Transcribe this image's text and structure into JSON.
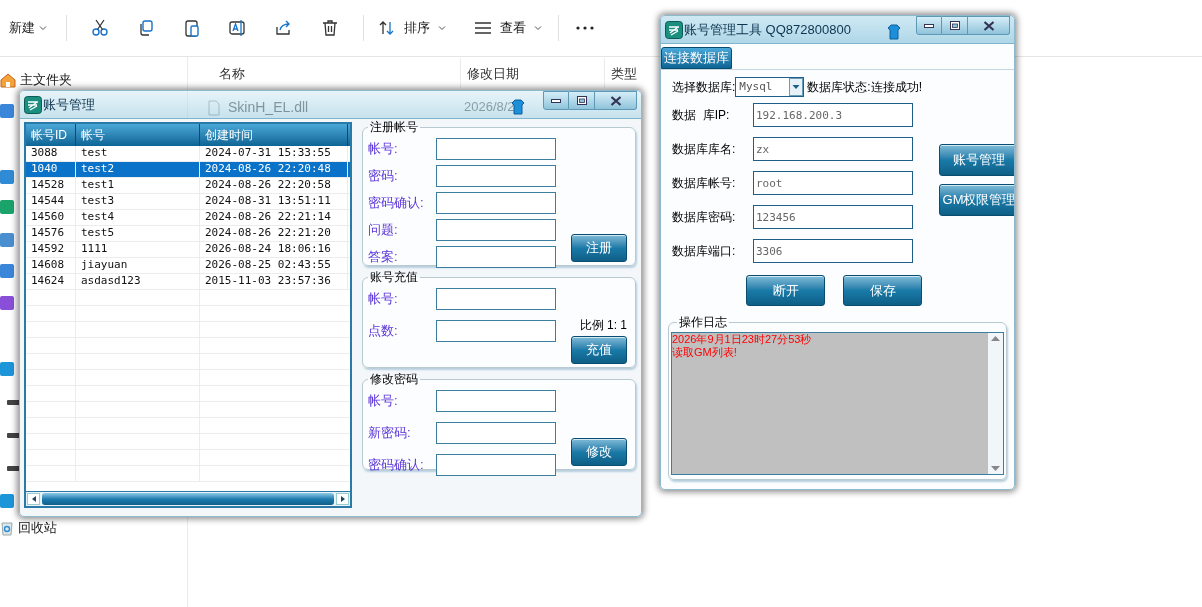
{
  "explorer": {
    "toolbar": {
      "new_label": "新建",
      "sort_label": "排序",
      "view_label": "查看"
    },
    "sidebar": [
      "主文件夹",
      "回收站"
    ],
    "columns": [
      "名称",
      "修改日期",
      "类型"
    ],
    "file": {
      "name": "SkinH_EL.dll",
      "modified": "2026/8/2"
    }
  },
  "account_window": {
    "title": "账号管理",
    "table": {
      "columns": [
        "帐号ID",
        "帐号",
        "创建时间"
      ],
      "rows": [
        {
          "id": "3088",
          "account": "test",
          "created": "2024-07-31 15:33:55",
          "selected": false
        },
        {
          "id": "1040",
          "account": "test2",
          "created": "2024-08-26 22:20:48",
          "selected": true
        },
        {
          "id": "14528",
          "account": "test1",
          "created": "2024-08-26 22:20:58",
          "selected": false
        },
        {
          "id": "14544",
          "account": "test3",
          "created": "2024-08-31 13:51:11",
          "selected": false
        },
        {
          "id": "14560",
          "account": "test4",
          "created": "2024-08-26 22:21:14",
          "selected": false
        },
        {
          "id": "14576",
          "account": "test5",
          "created": "2024-08-26 22:21:20",
          "selected": false
        },
        {
          "id": "14592",
          "account": "1111",
          "created": "2026-08-24 18:06:16",
          "selected": false
        },
        {
          "id": "14608",
          "account": "jiayuan",
          "created": "2026-08-25 02:43:55",
          "selected": false
        },
        {
          "id": "14624",
          "account": "asdasd123",
          "created": "2015-11-03 23:57:36",
          "selected": false
        }
      ]
    },
    "groups": [
      {
        "title": "注册帐号",
        "fields": [
          "帐号:",
          "密码:",
          "密码确认:",
          "问题:",
          "答案:"
        ],
        "button": "注册"
      },
      {
        "title": "账号充值",
        "fields": [
          "帐号:",
          "点数:"
        ],
        "note": "比例 1: 1",
        "button": "充值"
      },
      {
        "title": "修改密码",
        "fields": [
          "帐号:",
          "新密码:",
          "密码确认:"
        ],
        "button": "修改"
      }
    ]
  },
  "tool_window": {
    "title": "账号管理工具 QQ872800800",
    "tabs": [
      {
        "label": "连接数据库",
        "selected": true
      }
    ],
    "db_select": {
      "label": "选择数据库:",
      "value": "Mysql"
    },
    "status": "数据库状态:连接成功!",
    "fields": [
      {
        "label": "数据  库IP:",
        "value": "192.168.200.3"
      },
      {
        "label": "数据库库名:",
        "value": "zx"
      },
      {
        "label": "数据库帐号:",
        "value": "root"
      },
      {
        "label": "数据库密码:",
        "value": "123456"
      },
      {
        "label": "数据库端口:",
        "value": "3306"
      }
    ],
    "side_buttons": [
      "账号管理",
      "GM权限管理"
    ],
    "buttons": [
      "断开",
      "保存"
    ],
    "log": {
      "title": "操作日志",
      "lines": [
        "2026年9月1日23时27分53秒",
        "读取GM列表!"
      ]
    }
  }
}
